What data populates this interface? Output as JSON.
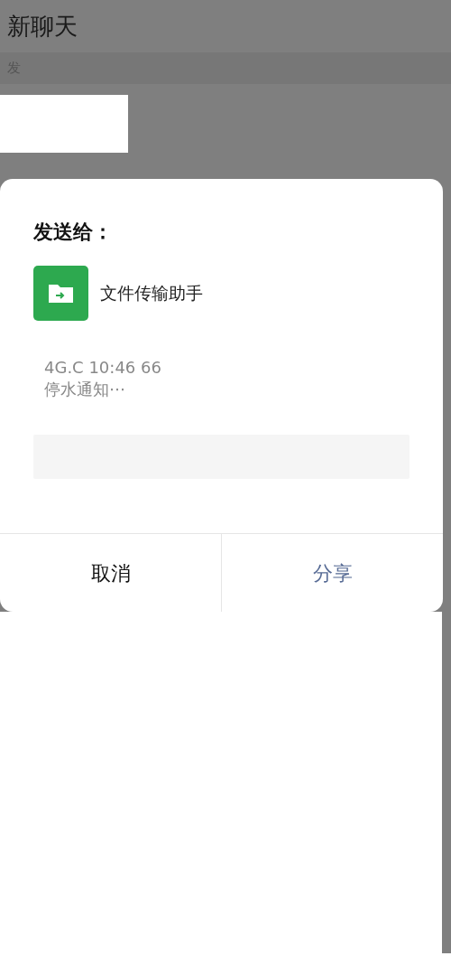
{
  "header": {
    "title": "新聊天"
  },
  "section": {
    "label": "发"
  },
  "dialog": {
    "title": "发送给：",
    "recipient": {
      "name": "文件传输助手"
    },
    "message": {
      "line_1": "4G.C 10:46 66",
      "line_2": "停水通知⋯"
    },
    "buttons": [
      {
        "label": "取消",
        "kind": "cancel"
      },
      {
        "label": "分享",
        "kind": "confirm"
      }
    ]
  }
}
